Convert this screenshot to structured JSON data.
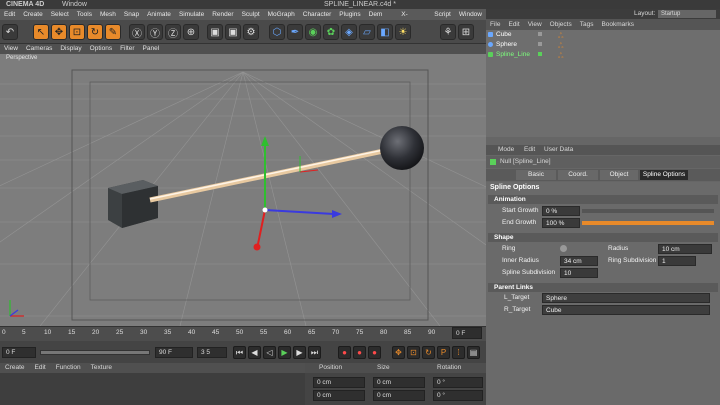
{
  "window": {
    "app_name": "CINEMA 4D",
    "window_label": "Window",
    "file_title": "SPLINE_LINEAR.c4d *"
  },
  "menubar": [
    "Edit",
    "Create",
    "Select",
    "Tools",
    "Mesh",
    "Snap",
    "Animate",
    "Simulate",
    "Render",
    "Sculpt",
    "MoGraph",
    "Character",
    "Plugins",
    "Dem Earth",
    "X-Particles",
    "Script",
    "Window"
  ],
  "layout": {
    "label": "Layout:",
    "value": "Startup"
  },
  "view_menu": [
    "View",
    "Cameras",
    "Display",
    "Options",
    "Filter",
    "Panel"
  ],
  "viewport": {
    "label": "Perspective"
  },
  "timeline": {
    "ticks": [
      "0",
      "5",
      "10",
      "15",
      "20",
      "25",
      "30",
      "35",
      "40",
      "45",
      "50",
      "55",
      "60",
      "65",
      "70",
      "75",
      "80",
      "85",
      "90"
    ],
    "frame_value": "0 F"
  },
  "transport": {
    "start_field": "0 F",
    "end_field": "90 F",
    "fps_field": "3 5"
  },
  "material_menu": [
    "Create",
    "Edit",
    "Function",
    "Texture"
  ],
  "coords": {
    "headers": [
      "Position",
      "Size",
      "Rotation"
    ],
    "rows": [
      [
        "0 cm",
        "0 cm",
        "0 °"
      ],
      [
        "0 cm",
        "0 cm",
        "0 °"
      ],
      [
        "0 cm",
        "0 cm",
        "0 °"
      ]
    ]
  },
  "object_menu": [
    "File",
    "Edit",
    "View",
    "Objects",
    "Tags",
    "Bookmarks"
  ],
  "objects": [
    "Cube",
    "Sphere",
    "Spline_Line"
  ],
  "attributes": {
    "menu": [
      "Mode",
      "Edit",
      "User Data"
    ],
    "name": "Null [Spline_Line]",
    "tabs": [
      "Basic",
      "Coord.",
      "Object",
      "Spline Options"
    ],
    "active_tab": "Spline Options",
    "section_title": "Spline Options",
    "animation": {
      "header": "Animation",
      "start_growth_label": "Start Growth",
      "start_growth_value": "0 %",
      "end_growth_label": "End Growth",
      "end_growth_value": "100 %"
    },
    "shape": {
      "header": "Shape",
      "ring_label": "Ring",
      "radius_label": "Radius",
      "radius_value": "10 cm",
      "inner_radius_label": "Inner Radius",
      "inner_radius_value": "34 cm",
      "ring_subdivision_label": "Ring Subdivision",
      "ring_subdivision_value": "1",
      "spline_subdivision_label": "Spline Subdivision",
      "spline_subdivision_value": "10"
    },
    "parent_links": {
      "header": "Parent Links",
      "l_target_label": "L_Target",
      "l_target_value": "Sphere",
      "r_target_label": "R_Target",
      "r_target_value": "Cube"
    }
  },
  "colors": {
    "accent_orange": "#e88a2a",
    "spline_active": "#2fd52f",
    "axis_x": "#3a3adf",
    "axis_y": "#2fbf2f",
    "axis_z": "#e02020"
  }
}
